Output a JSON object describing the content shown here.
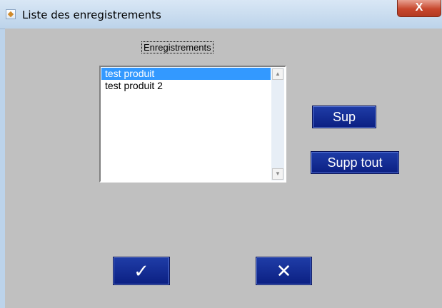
{
  "window": {
    "title": "Liste des enregistrements",
    "close_label": "X"
  },
  "form": {
    "group_label": "Enregistrements",
    "list": {
      "items": [
        {
          "label": "test produit",
          "selected": true
        },
        {
          "label": "test produit 2",
          "selected": false
        }
      ],
      "scroll_up_icon": "▲",
      "scroll_down_icon": "▼"
    },
    "buttons": {
      "delete_label": "Sup",
      "delete_all_label": "Supp tout",
      "ok_glyph": "✓",
      "cancel_glyph": "✕"
    }
  },
  "colors": {
    "client_bg": "#c0c0c0",
    "button_bg": "#1f3da7",
    "selection": "#3399ff",
    "close_button": "#c7472d"
  },
  "icons": {
    "app": "app-diamond-icon",
    "ok": "checkmark-icon",
    "cancel": "x-mark-icon"
  }
}
